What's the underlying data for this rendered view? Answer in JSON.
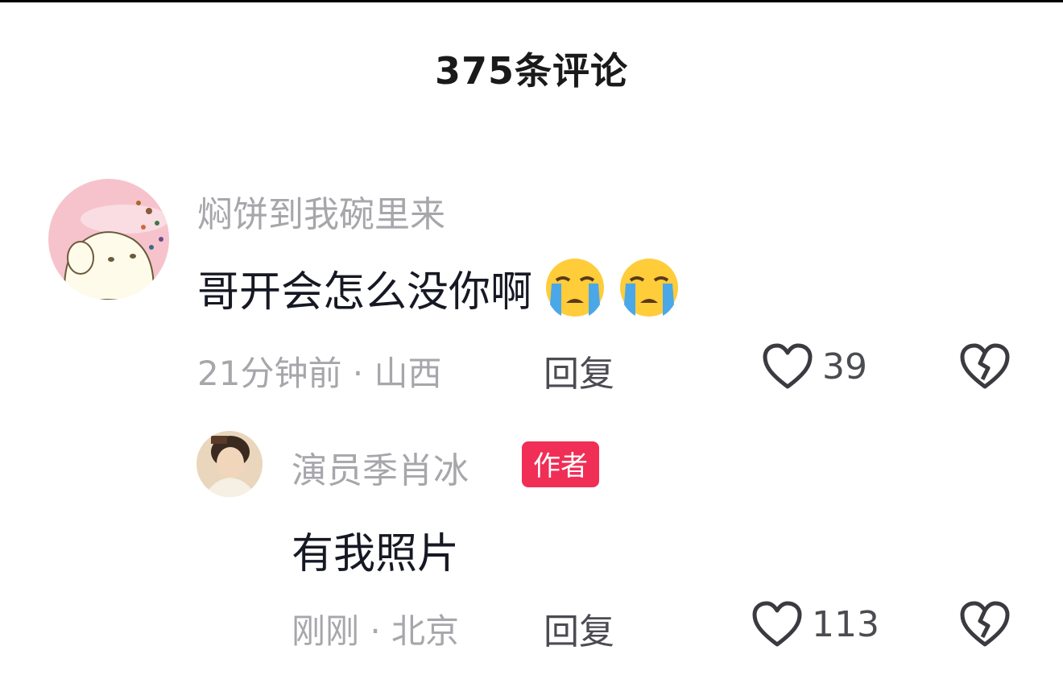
{
  "header": {
    "title": "375条评论"
  },
  "comments": [
    {
      "username": "焖饼到我碗里来",
      "text": "哥开会怎么没你啊",
      "emojis": [
        "loudly-crying-face-emoji",
        "loudly-crying-face-emoji"
      ],
      "meta": "21分钟前 · 山西",
      "reply_label": "回复",
      "likes": "39"
    }
  ],
  "replies": [
    {
      "username": "演员季肖冰",
      "badge": "作者",
      "text": "有我照片",
      "meta": "刚刚 · 北京",
      "reply_label": "回复",
      "likes": "113"
    }
  ],
  "colors": {
    "badge": "#f02e56",
    "muted_text": "#a6a6ab",
    "action_text": "#4b4b52"
  },
  "icons": [
    "heart-outline-icon",
    "broken-heart-icon"
  ]
}
